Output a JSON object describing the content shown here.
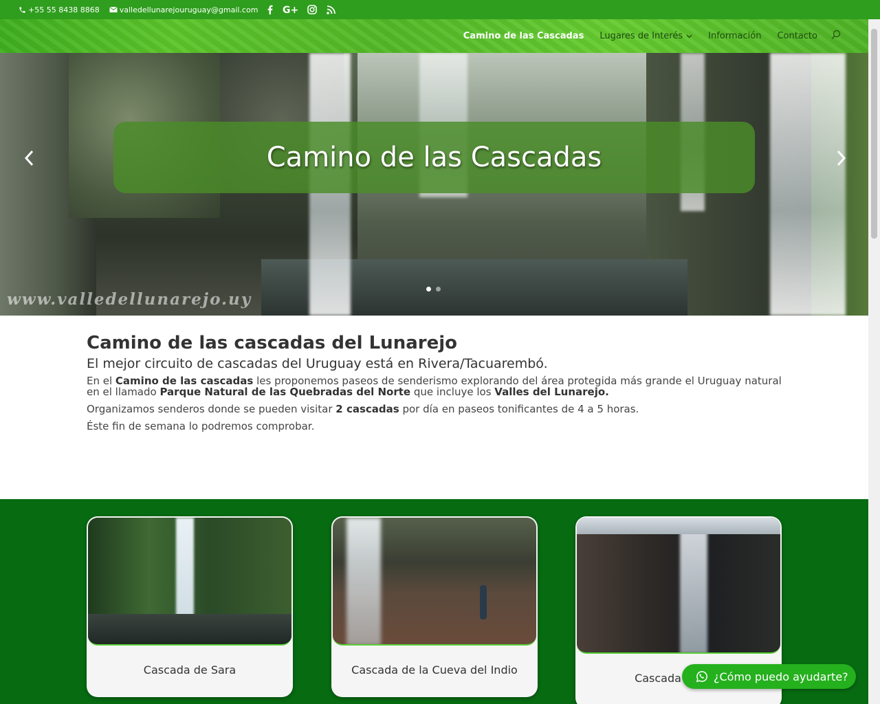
{
  "topbar": {
    "phone": "+55 55 8438 8868",
    "email": "valledellunarejouruguay@gmail.com",
    "social": [
      "facebook-icon",
      "google-plus-icon",
      "instagram-icon",
      "rss-icon"
    ]
  },
  "nav": {
    "items": [
      {
        "label": "Camino de las Cascadas",
        "active": true
      },
      {
        "label": "Lugares de Interés",
        "dropdown": true
      },
      {
        "label": "Información"
      },
      {
        "label": "Contacto"
      }
    ]
  },
  "hero": {
    "title": "Camino de las Cascadas",
    "watermark": "www.valledellunarejo.uy",
    "slide_count": 2,
    "active_slide": 1
  },
  "intro": {
    "title": "Camino de las cascadas del Lunarejo",
    "subtitle": "El mejor circuito de cascadas del Uruguay está en Rivera/Tacuarembó.",
    "p1_a": "En el ",
    "p1_b": "Camino de las  cascadas",
    "p1_c": " les proponemos paseos de senderismo explorando del área protegida más grande el Uruguay natural en el llamado ",
    "p1_d": "Parque Natural de las Quebradas del Norte",
    "p1_e": " que incluye los ",
    "p1_f": "Valles del Lunarejo.",
    "p2_a": "Organizamos senderos donde se pueden visitar ",
    "p2_b": "2 cascadas",
    "p2_c": " por día en paseos tonificantes de 4 a 5 horas.",
    "p3": "Éste fin de semana lo podremos comprobar."
  },
  "cards": [
    {
      "caption": "Cascada de Sara"
    },
    {
      "caption": "Cascada de la Cueva del Indio"
    },
    {
      "caption": "Cascada"
    }
  ],
  "whatsapp": {
    "label": "¿Cómo puedo ayudarte?"
  },
  "colors": {
    "topbar": "#2f9e1e",
    "band": "#076b12",
    "whatsapp": "#25b01e"
  }
}
